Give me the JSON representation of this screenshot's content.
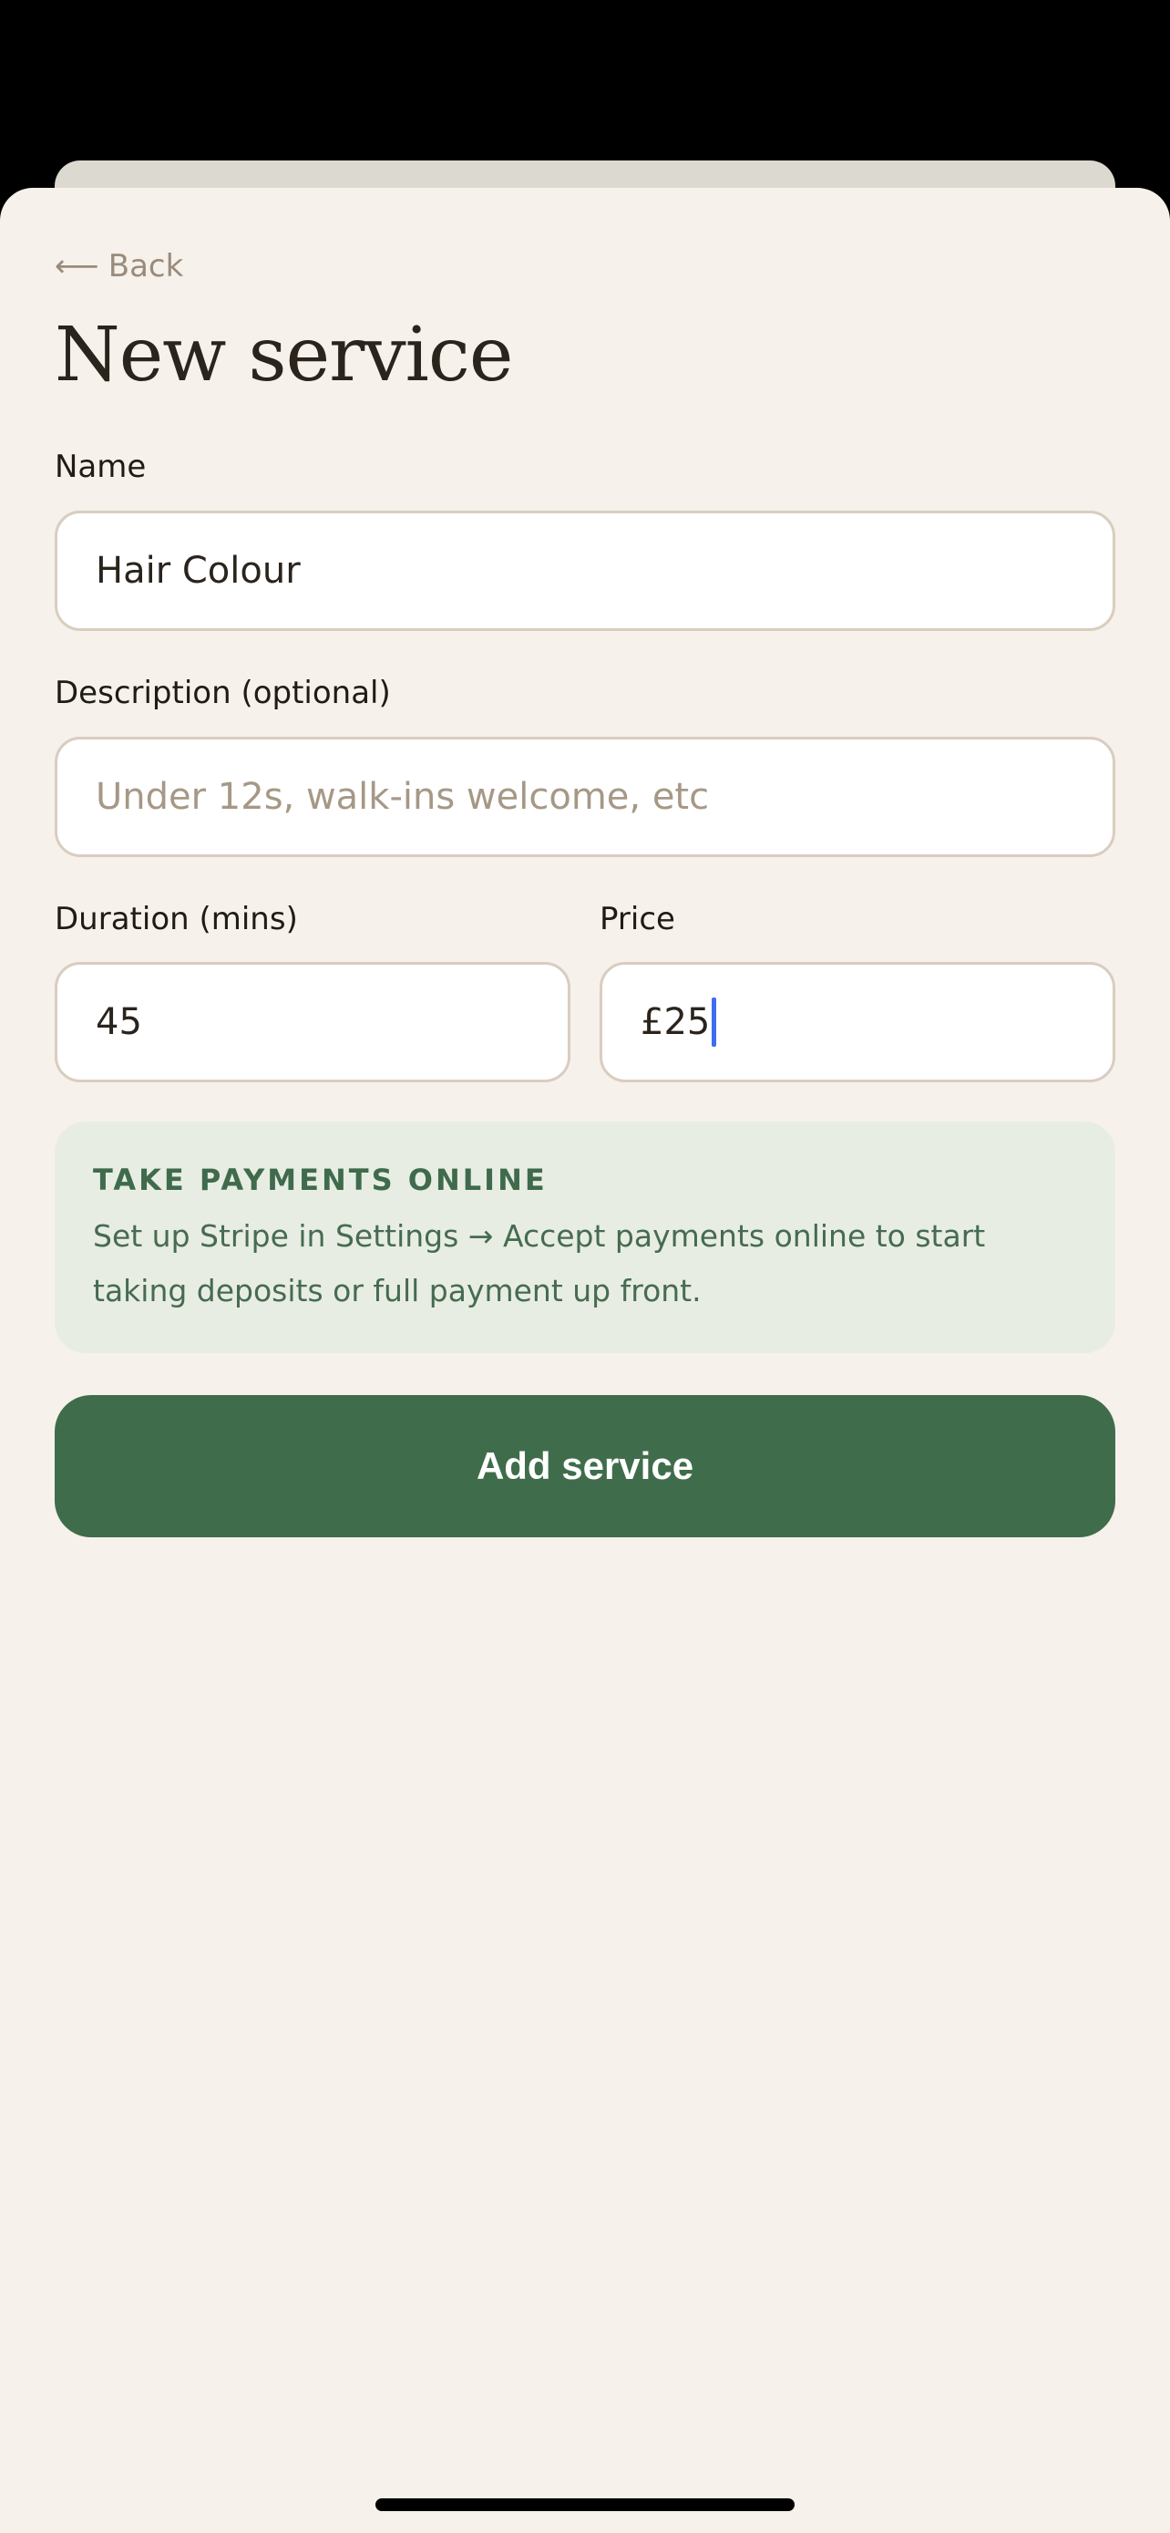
{
  "nav": {
    "back_label": "Back"
  },
  "page": {
    "title": "New service"
  },
  "form": {
    "name": {
      "label": "Name",
      "value": "Hair Colour"
    },
    "description": {
      "label": "Description (optional)",
      "placeholder": "Under 12s, walk-ins welcome, etc"
    },
    "duration": {
      "label": "Duration (mins)",
      "value": "45"
    },
    "price": {
      "label": "Price",
      "value": "£25"
    }
  },
  "info_box": {
    "title": "TAKE PAYMENTS ONLINE",
    "text": "Set up Stripe in Settings → Accept payments online to start taking deposits or full payment up front."
  },
  "actions": {
    "add_label": "Add service"
  },
  "colors": {
    "accent_green": "#3f6d4c",
    "background": "#f6f1eb",
    "info_background": "#e8ede3",
    "caret_blue": "#3d6df0"
  },
  "icons": {
    "back": "arrow-left-icon"
  }
}
